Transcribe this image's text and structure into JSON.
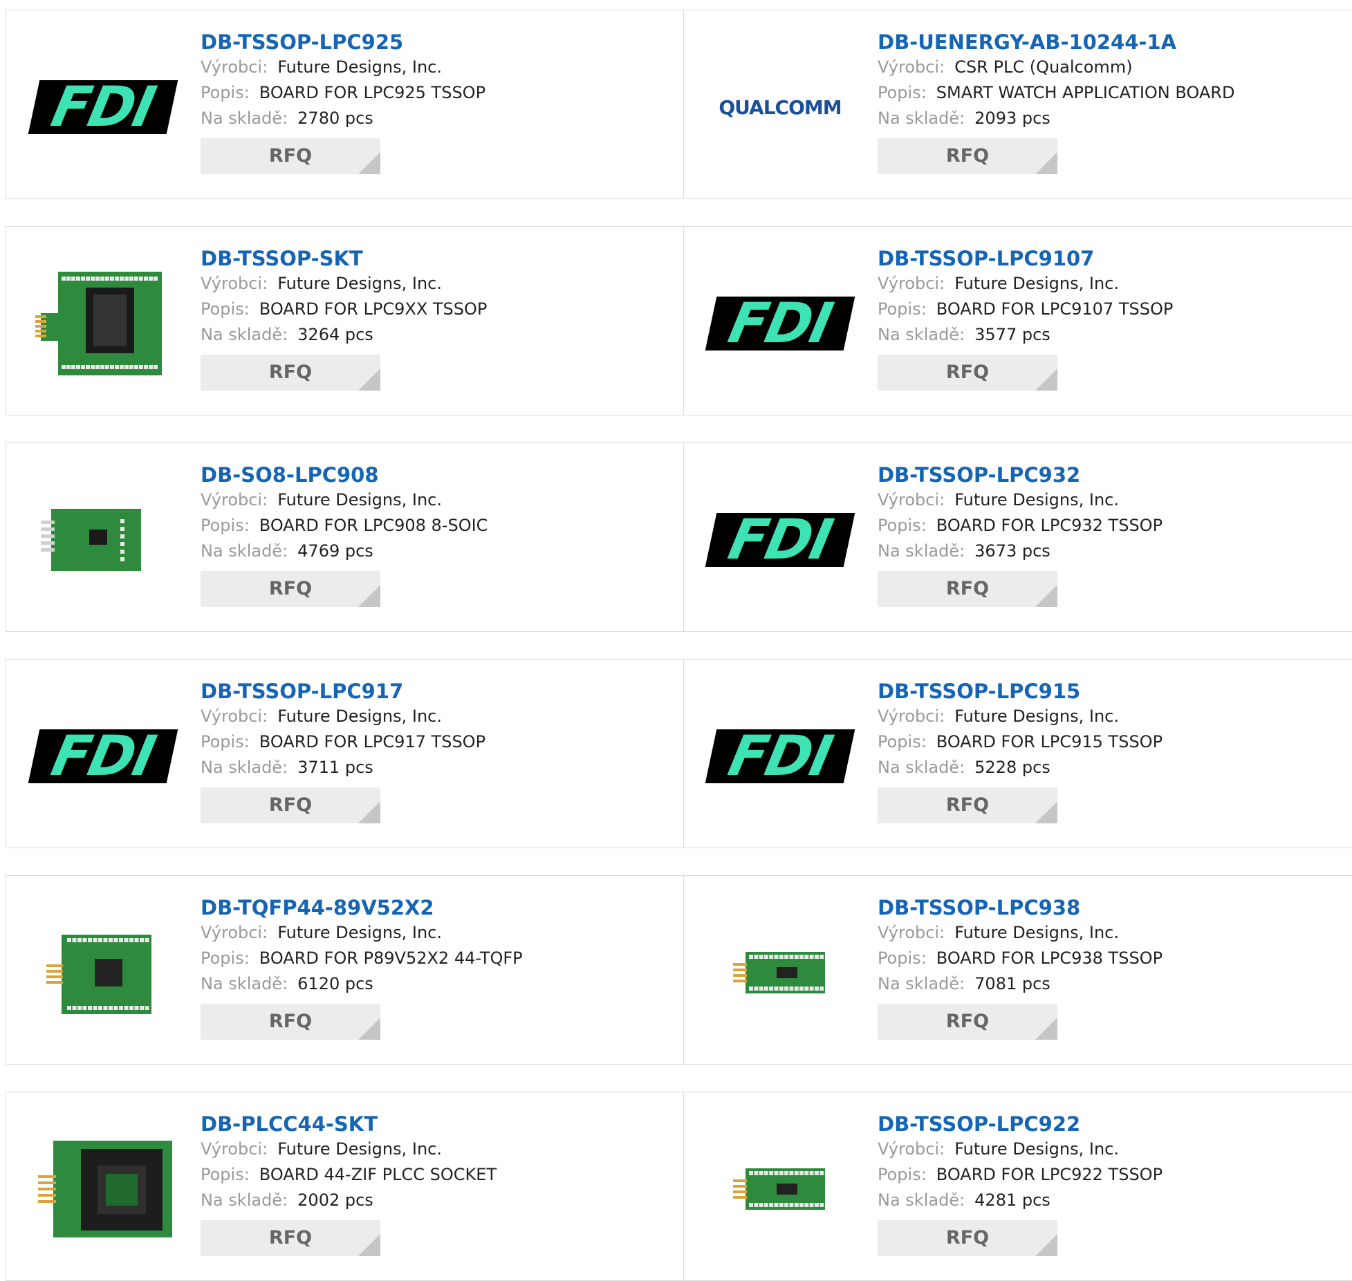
{
  "labels": {
    "manufacturer": "Výrobci:",
    "description": "Popis:",
    "stock": "Na skladě:",
    "rfq": "RFQ"
  },
  "colors": {
    "title_link": "#1565b4",
    "fdi_logo_green": "#3ee3b3",
    "rfq_bg": "#ececec"
  },
  "logos": {
    "fdi": "FDI",
    "qualcomm": "QUALCOMM"
  },
  "rows": [
    {
      "left": {
        "part": "DB-TSSOP-LPC925",
        "manufacturer": "Future Designs, Inc.",
        "description": "BOARD FOR LPC925 TSSOP",
        "stock": "2780 pcs",
        "image": "fdi-logo"
      },
      "right": {
        "part": "DB-UENERGY-AB-10244-1A",
        "manufacturer": "CSR PLC (Qualcomm)",
        "description": "SMART WATCH APPLICATION BOARD",
        "stock": "2093 pcs",
        "image": "qualcomm-logo"
      }
    },
    {
      "left": {
        "part": "DB-TSSOP-SKT",
        "manufacturer": "Future Designs, Inc.",
        "description": "BOARD FOR LPC9XX TSSOP",
        "stock": "3264 pcs",
        "image": "socket-board-photo"
      },
      "right": {
        "part": "DB-TSSOP-LPC9107",
        "manufacturer": "Future Designs, Inc.",
        "description": "BOARD FOR LPC9107 TSSOP",
        "stock": "3577 pcs",
        "image": "fdi-logo"
      }
    },
    {
      "left": {
        "part": "DB-SO8-LPC908",
        "manufacturer": "Future Designs, Inc.",
        "description": "BOARD FOR LPC908 8-SOIC",
        "stock": "4769 pcs",
        "image": "small-board-photo"
      },
      "right": {
        "part": "DB-TSSOP-LPC932",
        "manufacturer": "Future Designs, Inc.",
        "description": "BOARD FOR LPC932 TSSOP",
        "stock": "3673 pcs",
        "image": "fdi-logo"
      }
    },
    {
      "left": {
        "part": "DB-TSSOP-LPC917",
        "manufacturer": "Future Designs, Inc.",
        "description": "BOARD FOR LPC917 TSSOP",
        "stock": "3711 pcs",
        "image": "fdi-logo"
      },
      "right": {
        "part": "DB-TSSOP-LPC915",
        "manufacturer": "Future Designs, Inc.",
        "description": "BOARD FOR LPC915 TSSOP",
        "stock": "5228 pcs",
        "image": "fdi-logo"
      }
    },
    {
      "left": {
        "part": "DB-TQFP44-89V52X2",
        "manufacturer": "Future Designs, Inc.",
        "description": "BOARD FOR P89V52X2 44-TQFP",
        "stock": "6120 pcs",
        "image": "tqfp-board-photo"
      },
      "right": {
        "part": "DB-TSSOP-LPC938",
        "manufacturer": "Future Designs, Inc.",
        "description": "BOARD FOR LPC938 TSSOP",
        "stock": "7081 pcs",
        "image": "narrow-board-photo"
      }
    },
    {
      "left": {
        "part": "DB-PLCC44-SKT",
        "manufacturer": "Future Designs, Inc.",
        "description": "BOARD 44-ZIF PLCC SOCKET",
        "stock": "2002 pcs",
        "image": "plcc-socket-photo"
      },
      "right": {
        "part": "DB-TSSOP-LPC922",
        "manufacturer": "Future Designs, Inc.",
        "description": "BOARD FOR LPC922 TSSOP",
        "stock": "4281 pcs",
        "image": "narrow-board-photo"
      }
    }
  ]
}
